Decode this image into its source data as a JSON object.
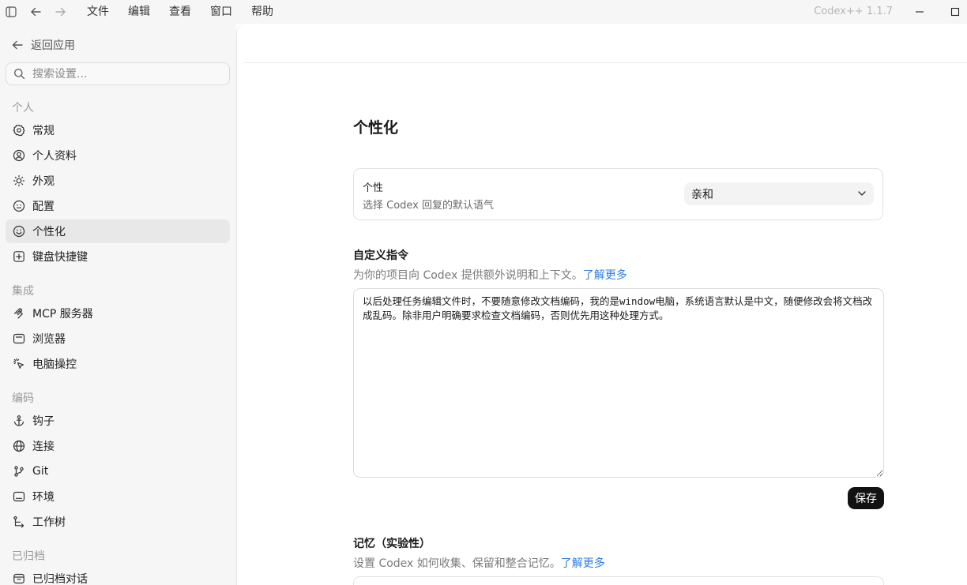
{
  "titlebar": {
    "menu": [
      "文件",
      "编辑",
      "查看",
      "窗口",
      "帮助"
    ],
    "app_version": "Codex++ 1.1.7"
  },
  "sidebar": {
    "back_label": "返回应用",
    "search_placeholder": "搜索设置...",
    "sections": {
      "personal": "个人",
      "integrations": "集成",
      "coding": "编码",
      "archived": "已归档"
    },
    "items": {
      "general": "常规",
      "profile": "个人资料",
      "appearance": "外观",
      "config": "配置",
      "personalization": "个性化",
      "shortcuts": "键盘快捷键",
      "mcp": "MCP 服务器",
      "browser": "浏览器",
      "computer_control": "电脑操控",
      "hooks": "钩子",
      "connections": "连接",
      "git": "Git",
      "environments": "环境",
      "worktrees": "工作树",
      "archived_chats": "已归档对话"
    },
    "active_item": "personalization"
  },
  "main": {
    "page_title": "个性化",
    "personality": {
      "title": "个性",
      "description": "选择 Codex 回复的默认语气",
      "selected": "亲和"
    },
    "custom_instructions": {
      "title": "自定义指令",
      "description": "为你的项目向 Codex 提供额外说明和上下文。",
      "learn_more": "了解更多",
      "value": "以后处理任务编辑文件时，不要随意修改文档编码，我的是window电脑，系统语言默认是中文，随便修改会将文档改成乱码。除非用户明确要求检查文档编码，否则优先用这种处理方式。",
      "save_label": "保存"
    },
    "memory": {
      "title": "记忆（实验性）",
      "description": "设置 Codex 如何收集、保留和整合记忆。",
      "learn_more": "了解更多"
    }
  },
  "colors": {
    "accent_link": "#2f7de1",
    "save_button_bg": "#121212",
    "sidebar_bg": "#f6f6f6",
    "active_item_bg": "#e8e8e8"
  }
}
